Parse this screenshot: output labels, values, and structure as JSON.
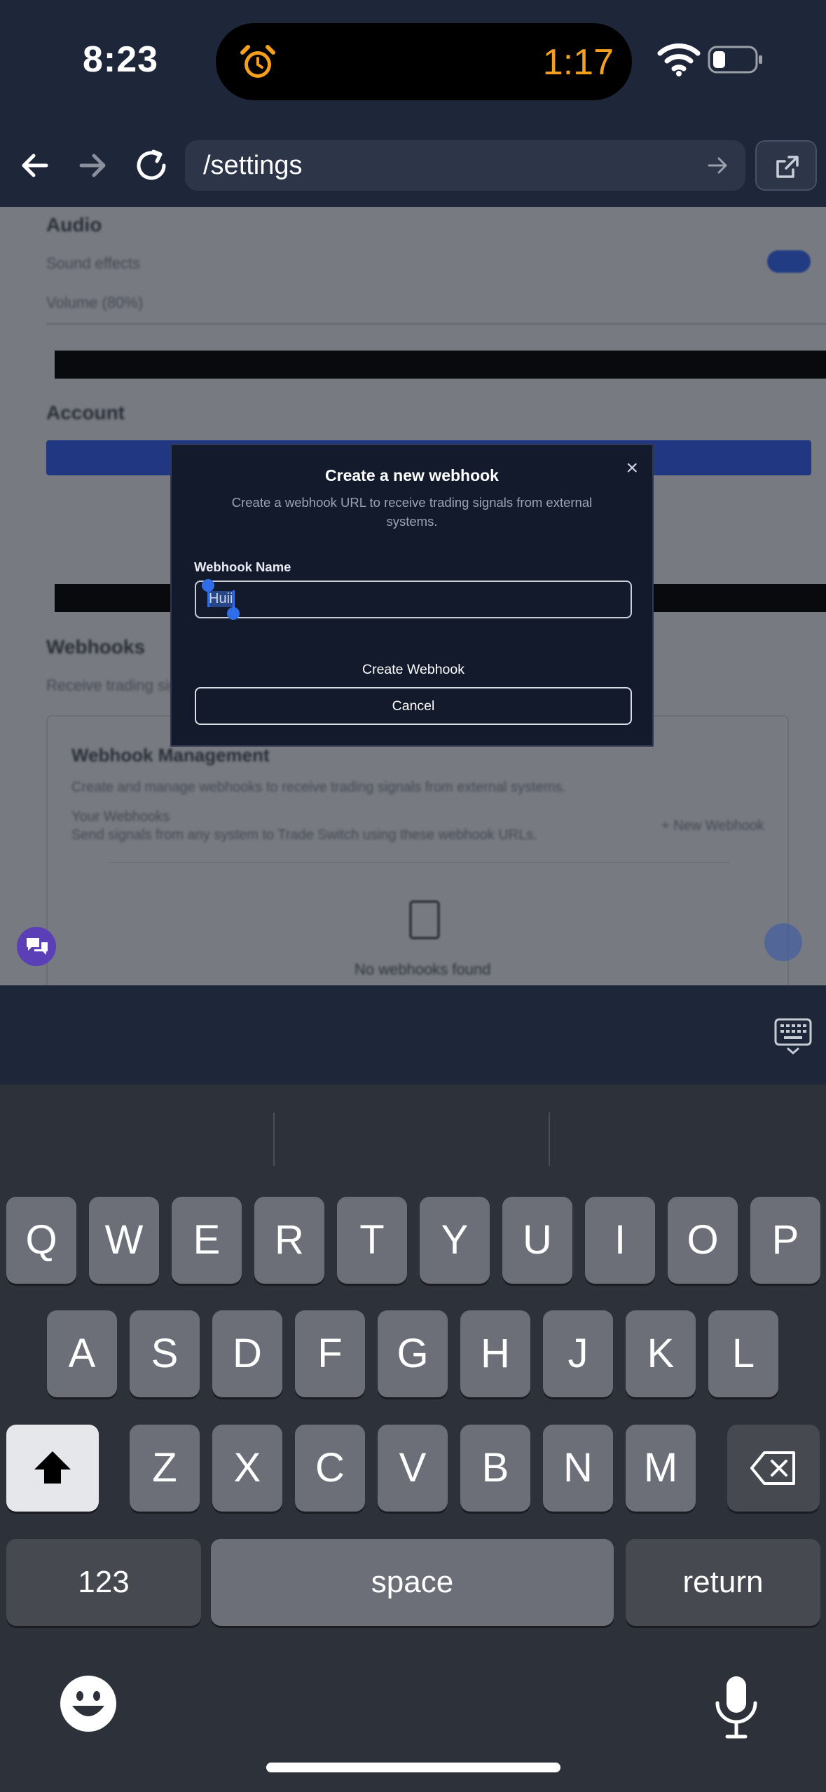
{
  "status_bar": {
    "time": "8:23",
    "timer": "1:17"
  },
  "browser": {
    "url": "/settings"
  },
  "background_page": {
    "audio_heading": "Audio",
    "sound_effects": "Sound effects",
    "volume": "Volume (80%)",
    "account_heading": "Account",
    "webhooks_heading": "Webhooks",
    "webhooks_sub": "Receive trading signals",
    "management_title": "Webhook Management",
    "management_desc": "Create and manage webhooks to receive trading signals from external systems.",
    "your_webhooks": "Your Webhooks",
    "your_webhooks_desc": "Send signals from any system to Trade Switch using these webhook URLs.",
    "new_webhook": "+ New Webhook",
    "empty_state": "No webhooks found"
  },
  "modal": {
    "title": "Create a new webhook",
    "description": "Create a webhook URL to receive trading signals from external systems.",
    "name_label": "Webhook Name",
    "name_value": "Huii",
    "create_label": "Create Webhook",
    "cancel_label": "Cancel",
    "close_label": "×"
  },
  "keyboard": {
    "row1": [
      "Q",
      "W",
      "E",
      "R",
      "T",
      "Y",
      "U",
      "I",
      "O",
      "P"
    ],
    "row2": [
      "A",
      "S",
      "D",
      "F",
      "G",
      "H",
      "J",
      "K",
      "L"
    ],
    "row3": [
      "Z",
      "X",
      "C",
      "V",
      "B",
      "N",
      "M"
    ],
    "numbers_label": "123",
    "space_label": "space",
    "return_label": "return"
  }
}
